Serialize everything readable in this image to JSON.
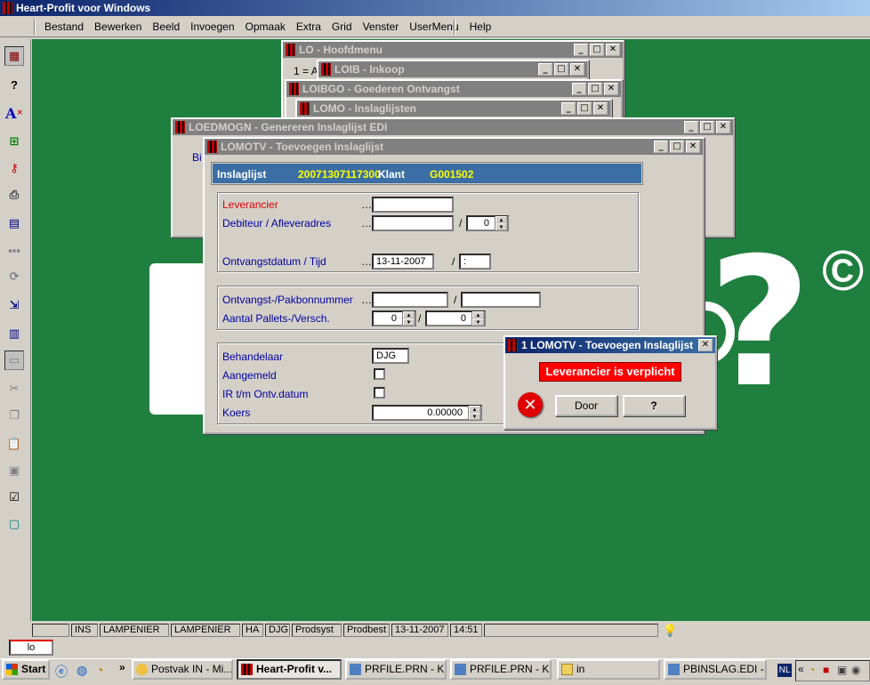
{
  "app": {
    "title": "Heart-Profit voor Windows"
  },
  "menu": [
    "Bestand",
    "Bewerken",
    "Beeld",
    "Invoegen",
    "Opmaak",
    "Extra",
    "Grid",
    "Venster",
    "UserMenu",
    "Help"
  ],
  "windows": {
    "lo": {
      "title": "LO - Hoofdmenu",
      "content_text": "1 = A"
    },
    "loib": {
      "title": "LOIB - Inkoop"
    },
    "loibgo": {
      "title": "LOIBGO - Goederen Ontvangst"
    },
    "lomo": {
      "title": "LOMO - Inslaglijsten"
    },
    "loedmogn": {
      "title": "LOEDMOGN - Genereren Inslaglijst EDI",
      "content_text": "Bi"
    }
  },
  "form": {
    "title": "LOMOTV - Toevoegen Inslaglijst",
    "header": {
      "label": "Inslaglijst",
      "number": "20071307117300",
      "klant_label": "Klant",
      "klant_value": "G001502"
    },
    "fields": {
      "leverancier_label": "Leverancier",
      "leverancier_value": "",
      "debiteur_label": "Debiteur / Afleveradres",
      "debiteur_value": "",
      "debiteur_adres": "0",
      "ontvangstdatum_label": "Ontvangstdatum / Tijd",
      "ontvangstdatum_value": "13-11-2007",
      "tijd_value": ":",
      "pakbon_label": "Ontvangst-/Pakbonnummer",
      "pakbon_ontvangst": "",
      "pakbon_nummer": "",
      "pallets_label": "Aantal Pallets-/Versch.",
      "pallets_value": "0",
      "versch_value": "0",
      "behandelaar_label": "Behandelaar",
      "behandelaar_value": "DJG",
      "aangemeld_label": "Aangemeld",
      "ir_label": "IR t/m Ontv.datum",
      "koers_label": "Koers",
      "koers_value": "0.00000"
    }
  },
  "dialog": {
    "title": "1 LOMOTV - Toevoegen Inslaglijst",
    "message": "Leverancier is verplicht",
    "door_label": "Door",
    "help_label": "?"
  },
  "statusbar": {
    "cells": [
      "",
      "INS",
      "LAMPENIER",
      "LAMPENIER",
      "HA",
      "DJG",
      "Prodsyst",
      "Prodbest",
      "13-11-2007",
      "14:51"
    ]
  },
  "command": {
    "value": "lo"
  },
  "taskbar": {
    "start_label": "Start",
    "buttons": [
      "Postvak IN - Mi...",
      "Heart-Profit v...",
      "PRFILE.PRN - Kl...",
      "PRFILE.PRN - Kl...",
      "in",
      "PBINSLAG.EDI -..."
    ],
    "tray_lang": "NL"
  },
  "colors": {
    "desktop_green": "#1f7f3f",
    "titlebar_active": "#0a246a",
    "error_red": "#ff0000"
  }
}
